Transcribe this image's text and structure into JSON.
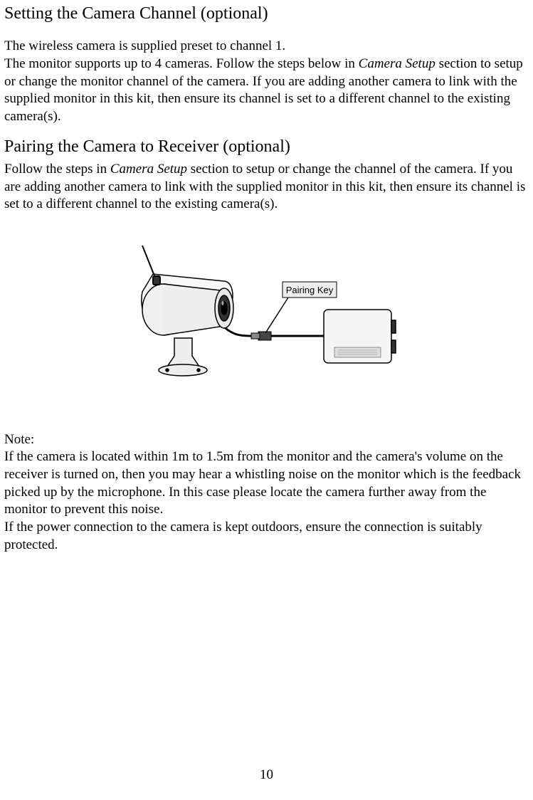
{
  "section1": {
    "heading": "Setting the Camera Channel (optional)",
    "p1": "The wireless camera is supplied preset to channel 1.",
    "p2a": "The monitor supports up to 4 cameras. Follow the steps below in ",
    "p2_em": "Camera Setup",
    "p2b": " section to setup or change the monitor channel of the camera. If you are adding another camera to link with the supplied monitor in this kit, then ensure its channel is set to a different channel to the existing camera(s)."
  },
  "section2": {
    "heading": "Pairing the Camera to Receiver (optional)",
    "p1a": "Follow the steps in ",
    "p1_em": "Camera Setup",
    "p1b": " section to setup or change the channel of the camera. If you are adding another camera to link with the supplied monitor in this kit, then ensure its channel is set to a different channel to the existing camera(s)."
  },
  "figure": {
    "label": "Pairing Key"
  },
  "note": {
    "heading": "Note:",
    "p1": "If the camera is located within 1m to 1.5m from the monitor and the camera's volume on the receiver is turned on, then you may hear a whistling noise on the monitor which is the feedback picked up by the microphone. In this case please locate the camera further away from the monitor to prevent this noise.",
    "p2": "If the power connection to the camera is kept outdoors, ensure the connection is suitably protected."
  },
  "page_number": "10"
}
